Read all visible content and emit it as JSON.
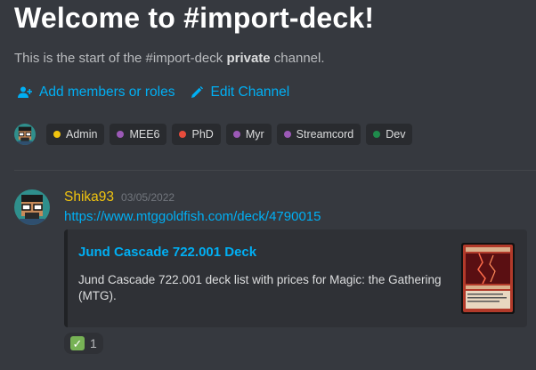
{
  "channel": {
    "welcome_title": "Welcome to #import-deck!",
    "subtitle_prefix": "This is the start of the #import-deck ",
    "subtitle_bold": "private",
    "subtitle_suffix": " channel."
  },
  "actions": {
    "add_members": "Add members or roles",
    "edit_channel": "Edit Channel"
  },
  "roles": [
    {
      "label": "Admin",
      "color": "#f1c40f"
    },
    {
      "label": "MEE6",
      "color": "#9b59b6"
    },
    {
      "label": "PhD",
      "color": "#e74c3c"
    },
    {
      "label": "Myr",
      "color": "#9b59b6"
    },
    {
      "label": "Streamcord",
      "color": "#9b59b6"
    },
    {
      "label": "Dev",
      "color": "#1f8b4c"
    }
  ],
  "message": {
    "username": "Shika93",
    "username_color": "#f1c40f",
    "timestamp": "03/05/2022",
    "link": "https://www.mtggoldfish.com/deck/4790015",
    "embed": {
      "title": "Jund Cascade 722.001  Deck",
      "description": "Jund Cascade 722.001 deck list with prices for Magic: the Gathering (MTG)."
    },
    "reaction": {
      "emoji": "white-check-mark",
      "count": "1"
    }
  },
  "colors": {
    "background": "#36393f",
    "link": "#00aff4",
    "embed_bg": "#2f3136"
  }
}
